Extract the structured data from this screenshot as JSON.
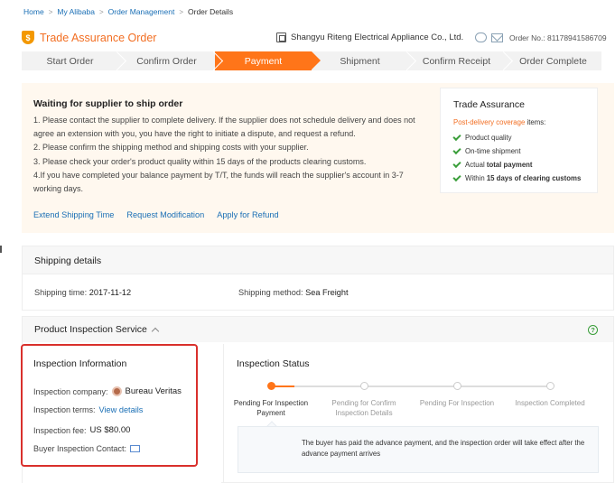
{
  "breadcrumb": [
    "Home",
    "My Alibaba",
    "Order Management",
    "Order Details"
  ],
  "title": "Trade Assurance Order",
  "supplier": "Shangyu Riteng Electrical Appliance Co., Ltd.",
  "order_no": "Order No.: 81178941586709",
  "steps": [
    {
      "label": "Start Order",
      "active": false
    },
    {
      "label": "Confirm Order",
      "active": false
    },
    {
      "label": "Payment",
      "active": true
    },
    {
      "label": "Shipment",
      "active": false
    },
    {
      "label": "Confirm Receipt",
      "active": false
    },
    {
      "label": "Order Complete",
      "active": false
    }
  ],
  "notice": {
    "heading": "Waiting for supplier to ship order",
    "lines": [
      "1. Please contact the supplier to complete delivery. If the supplier does not schedule delivery and does not agree an extension with you, you have the right to initiate a dispute, and request a refund.",
      "2. Please confirm the shipping method and shipping costs with your supplier.",
      "3. Please check your order's product quality within 15 days of the products clearing customs.",
      "4.If you have completed your balance payment by T/T, the funds will reach the supplier's account in 3-7 working days."
    ],
    "links": [
      "Extend Shipping Time",
      "Request Modification",
      "Apply for Refund"
    ]
  },
  "assurance": {
    "title": "Trade Assurance",
    "sub_highlight": "Post-delivery coverage",
    "sub_rest": " items:",
    "items": [
      {
        "pre": "Product quality",
        "bold": "",
        "post": ""
      },
      {
        "pre": "On-time shipment",
        "bold": "",
        "post": ""
      },
      {
        "pre": "Actual ",
        "bold": "total payment",
        "post": ""
      },
      {
        "pre": "Within ",
        "bold": "15 days of clearing customs",
        "post": ""
      }
    ]
  },
  "shipping": {
    "header": "Shipping details",
    "time_label": "Shipping time:",
    "time_value": "2017-11-12",
    "method_label": "Shipping method:",
    "method_value": "Sea Freight"
  },
  "inspection": {
    "header": "Product Inspection Service",
    "help": "?",
    "info_title": "Inspection Information",
    "company_label": "Inspection company:",
    "company_value": "Bureau Veritas",
    "terms_label": "Inspection terms:",
    "terms_link": "View details",
    "fee_label": "Inspection fee:",
    "fee_value": "US $80.00",
    "contact_label": "Buyer Inspection Contact:",
    "status_title": "Inspection Status",
    "status_steps": [
      {
        "label": "Pending For Inspection Payment",
        "on": true
      },
      {
        "label": "Pending for Confirm Inspection Details",
        "on": false
      },
      {
        "label": "Pending For Inspection",
        "on": false
      },
      {
        "label": "Inspection Completed",
        "on": false
      }
    ],
    "message": "The buyer has paid the advance payment, and the inspection order will take effect after the advance payment arrives"
  },
  "colors": {
    "accent": "#ff7519",
    "link": "#1a6fb5",
    "highlight_box": "#d9302c"
  }
}
